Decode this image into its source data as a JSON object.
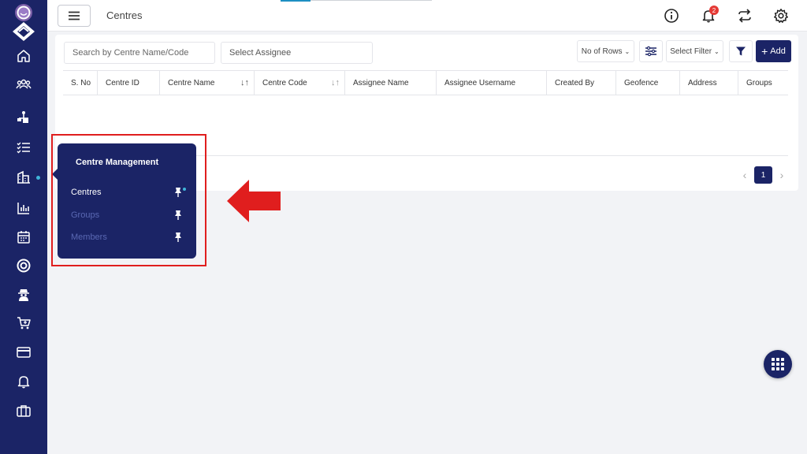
{
  "header": {
    "title": "Centres",
    "notification_count": "2"
  },
  "toolbar": {
    "search_placeholder": "Search by Centre Name/Code",
    "assignee_placeholder": "Select Assignee",
    "rows_label": "No of Rows",
    "filter_label": "Select Filter",
    "add_label": "Add"
  },
  "table": {
    "columns": [
      "S. No",
      "Centre ID",
      "Centre Name",
      "Centre Code",
      "Assignee Name",
      "Assignee Username",
      "Created By",
      "Geofence",
      "Address",
      "Groups"
    ]
  },
  "pagination": {
    "current_page": "1"
  },
  "popup": {
    "title": "Centre Management",
    "items": [
      {
        "label": "Centres"
      },
      {
        "label": "Groups"
      },
      {
        "label": "Members"
      }
    ]
  },
  "sidebar": {
    "icons": [
      "home-icon",
      "users-icon",
      "hierarchy-icon",
      "checklist-icon",
      "building-icon",
      "chart-icon",
      "calendar-icon",
      "target-icon",
      "spy-icon",
      "cart-icon",
      "card-icon",
      "bell-icon",
      "briefcase-icon"
    ]
  },
  "colors": {
    "brand": "#1b2466",
    "accent": "#3fb5d9",
    "annotation": "#e01e1e"
  }
}
